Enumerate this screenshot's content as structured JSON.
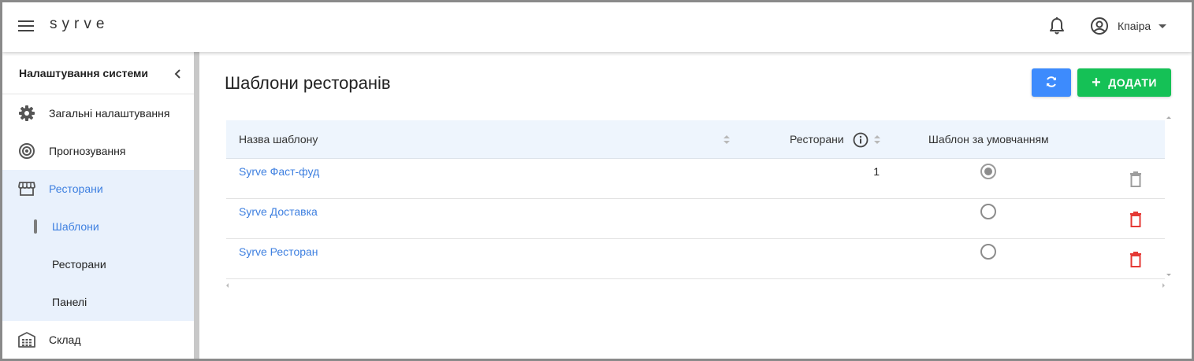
{
  "app": {
    "logo": "syrve",
    "user_name": "Кпаіра"
  },
  "sidebar": {
    "title": "Налаштування системи",
    "items": [
      {
        "label": "Загальні налаштування",
        "icon": "gear-icon"
      },
      {
        "label": "Прогнозування",
        "icon": "target-icon"
      },
      {
        "label": "Ресторани",
        "icon": "store-icon",
        "active": true
      },
      {
        "label": "Склад",
        "icon": "warehouse-icon"
      }
    ],
    "subitems": [
      {
        "label": "Шаблони",
        "active": true
      },
      {
        "label": "Ресторани"
      },
      {
        "label": "Панелі"
      }
    ]
  },
  "main": {
    "title": "Шаблони ресторанів",
    "add_button": "ДОДАТИ",
    "refresh_icon": "refresh-icon",
    "table": {
      "columns": [
        "Назва шаблону",
        "Ресторани",
        "Шаблон за умовчанням"
      ],
      "rows": [
        {
          "name": "Syrve Фаст-фуд",
          "restaurants": "1",
          "default": true,
          "delete_enabled": false
        },
        {
          "name": "Syrve Доставка",
          "restaurants": "",
          "default": false,
          "delete_enabled": true
        },
        {
          "name": "Syrve Ресторан",
          "restaurants": "",
          "default": false,
          "delete_enabled": true
        }
      ]
    }
  },
  "colors": {
    "accent_blue": "#3d7fe0",
    "refresh_button": "#3d8bfd",
    "add_button": "#15c156",
    "delete_active": "#e53935",
    "delete_disabled": "#9e9e9e",
    "active_bg": "#e9f1fc"
  }
}
